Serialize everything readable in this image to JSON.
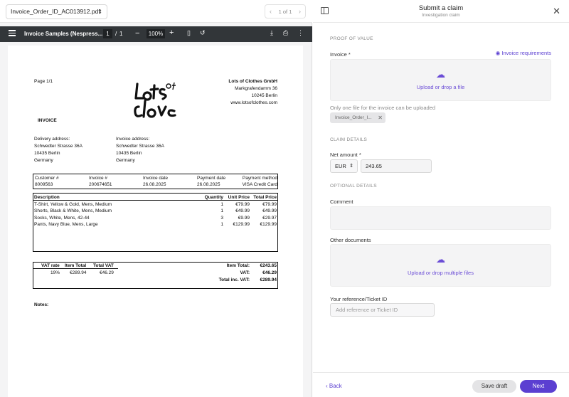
{
  "viewer": {
    "file_name": "Invoice_Order_ID_AC013912.pdf",
    "page_indicator": "1 of 1",
    "doc_title": "Invoice Samples (Nespress...",
    "page_current": "1",
    "page_separator": "/",
    "page_total": "1",
    "zoom": "100%"
  },
  "invoice": {
    "page_label": "Page 1/1",
    "company_name": "Lots of Clothes GmbH",
    "company_street": "Markgrafendamm 36",
    "company_city": "10245 Berlin",
    "company_web": "www.lotsofclothes.com",
    "heading": "INVOICE",
    "delivery_label": "Delivery address:",
    "delivery_lines": [
      "Schwedter Strasse 36A",
      "10435 Berlin",
      "Germany"
    ],
    "invoice_addr_label": "Invoice address:",
    "invoice_addr_lines": [
      "Schwedter Strasse 36A",
      "10435 Berlin",
      "Germany"
    ],
    "meta_headers": [
      "Customer #",
      "Invoice #",
      "Invoice date",
      "Payment date",
      "Payment method"
    ],
    "meta_values": [
      "8009563",
      "200674651",
      "26.08.2025",
      "26.08.2025",
      "VISA Credit Card"
    ],
    "item_headers": [
      "Description",
      "Quantity",
      "Unit Price",
      "Total Price"
    ],
    "items": [
      [
        "T-Shirt, Yellow & Gold, Mens, Medium",
        "1",
        "€79.99",
        "€79.99"
      ],
      [
        "Shorts, Black & White, Mens, Medium",
        "1",
        "€49.99",
        "€49.99"
      ],
      [
        "Socks, White, Mens, 42-44",
        "3",
        "€9.99",
        "€29.97"
      ],
      [
        "Pants, Navy Blue, Mens, Large",
        "1",
        "€129.99",
        "€129.99"
      ]
    ],
    "vat_headers": [
      "VAT rate",
      "Item Total",
      "Total VAT"
    ],
    "vat_values": [
      "19%",
      "€289.94",
      "€46.29"
    ],
    "totals": [
      [
        "Item Total:",
        "€243.65"
      ],
      [
        "VAT:",
        "€46.29"
      ],
      [
        "Total inc. VAT:",
        "€289.94"
      ]
    ],
    "notes_label": "Notes:",
    "logo_text": "Lots of Clothes"
  },
  "claim": {
    "title": "Submit a claim",
    "subtitle": "Investigation claim",
    "proof_section": "PROOF OF VALUE",
    "invoice_label": "Invoice *",
    "invoice_requirements": "Invoice requirements",
    "upload_text": "Upload or drop a file",
    "one_file_hint": "Only one file for the invoice can be uploaded",
    "uploaded_chip": "Invoice_Order_I...",
    "claim_details_section": "CLAIM DETAILS",
    "net_amount_label": "Net amount *",
    "currency": "EUR",
    "amount": "243.65",
    "optional_section": "OPTIONAL DETAILS",
    "comment_label": "Comment",
    "other_docs_label": "Other documents",
    "upload_multi_text": "Upload or drop multiple files",
    "reference_label": "Your reference/Ticket ID",
    "reference_placeholder": "Add reference or Ticket ID",
    "back_label": "Back",
    "save_draft_label": "Save draft",
    "next_label": "Next"
  },
  "colors": {
    "accent": "#5b3fd1",
    "pdf_toolbar": "#323639"
  },
  "icons": [
    "chevron-down-icon",
    "chevron-left-icon",
    "chevron-right-icon",
    "sidebar-toggle-icon",
    "close-icon",
    "menu-icon",
    "download-icon",
    "print-icon",
    "more-icon",
    "fit-page-icon",
    "rotate-icon",
    "cloud-upload-icon",
    "eye-icon"
  ]
}
